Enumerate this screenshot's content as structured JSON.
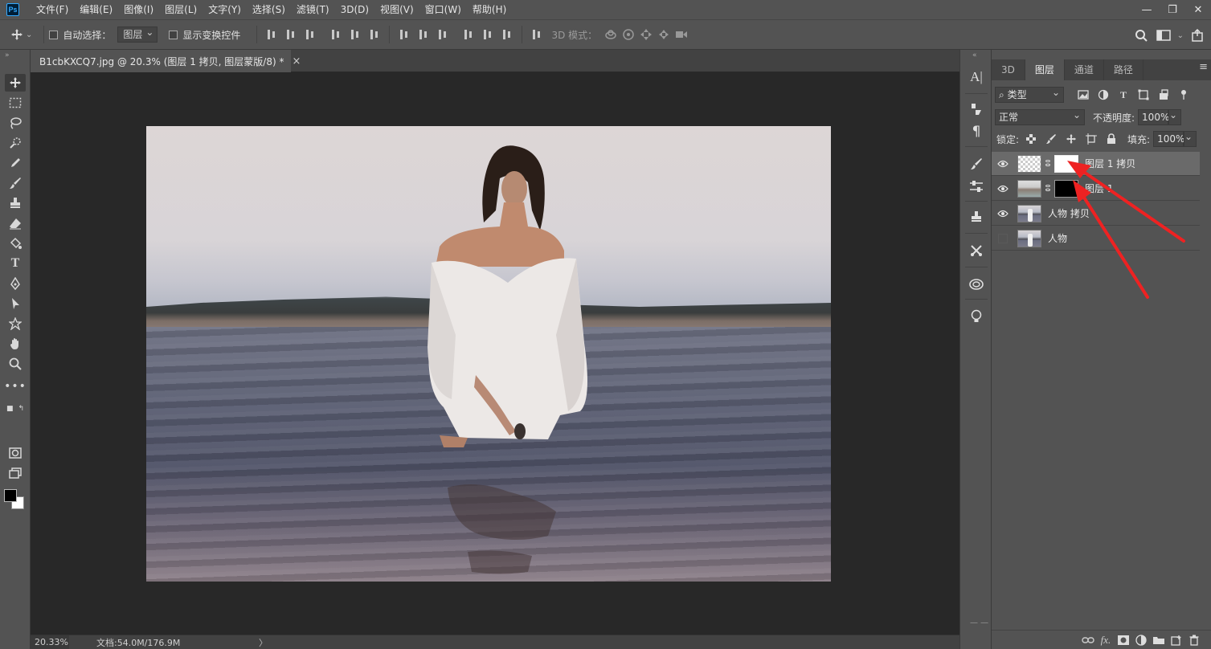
{
  "app": {
    "logo": "Ps"
  },
  "menu": [
    "文件(F)",
    "编辑(E)",
    "图像(I)",
    "图层(L)",
    "文字(Y)",
    "选择(S)",
    "滤镜(T)",
    "3D(D)",
    "视图(V)",
    "窗口(W)",
    "帮助(H)"
  ],
  "window_controls": {
    "minimize": "—",
    "restore": "❐",
    "close": "✕"
  },
  "options": {
    "auto_select_label": "自动选择：",
    "auto_select_value": "图层",
    "show_transform_label": "显示变换控件",
    "mode_3d_label": "3D 模式："
  },
  "document": {
    "tab_title": "B1cbKXCQ7.jpg @ 20.3% (图层 1 拷贝, 图层蒙版/8) *",
    "tab_close": "×"
  },
  "status": {
    "zoom": "20.33%",
    "doc_info": "文档:54.0M/176.9M",
    "arrow": "〉"
  },
  "panel": {
    "tabs": [
      "3D",
      "图层",
      "通道",
      "路径"
    ],
    "active_tab": "图层",
    "menu_icon": "≡",
    "filter_kind": "类型",
    "filter_prefix": "⌕",
    "blend_mode": "正常",
    "opacity_label": "不透明度:",
    "opacity_value": "100%",
    "lock_label": "锁定:",
    "fill_label": "填充:",
    "fill_value": "100%"
  },
  "layers": [
    {
      "name": "图层 1 拷贝",
      "visible": true,
      "selected": true,
      "mask_color": "#ffffff",
      "thumb": "checker"
    },
    {
      "name": "图层 1",
      "visible": true,
      "selected": false,
      "mask_color": "#000000",
      "thumb": "shore"
    },
    {
      "name": "人物 拷贝",
      "visible": true,
      "selected": false,
      "mask_color": null,
      "thumb": "photo"
    },
    {
      "name": "人物",
      "visible": false,
      "selected": false,
      "mask_color": null,
      "thumb": "photo"
    }
  ],
  "panel_footer_icons": [
    "link-icon",
    "fx-icon",
    "mask-icon",
    "adjustment-icon",
    "folder-icon",
    "new-layer-icon",
    "trash-icon"
  ],
  "annotation_color": "#ee2222"
}
